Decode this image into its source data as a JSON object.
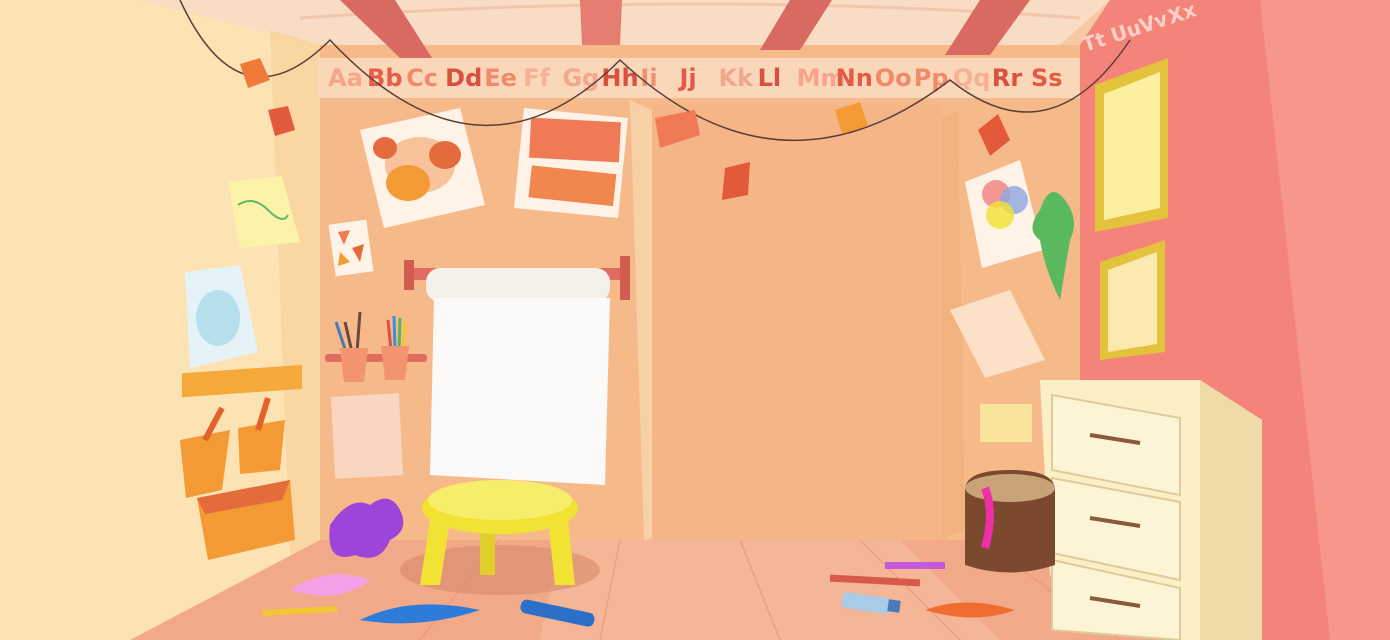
{
  "scene": {
    "alphabet": [
      "Aa",
      "Bb",
      "Cc",
      "Dd",
      "Ee",
      "Ff",
      "Gg",
      "Hh",
      "Ii",
      "Jj",
      "Kk",
      "Ll",
      "Mm",
      "Nn",
      "Oo",
      "Pp",
      "Qq",
      "Rr",
      "Ss"
    ],
    "alphabet_right": [
      "Tt",
      "Uu",
      "Vv",
      "Xx"
    ],
    "alphabet_colors": [
      "#f7a48a",
      "#e85c4a",
      "#f08a6a",
      "#d9503f",
      "#f08a6a",
      "#f7b096",
      "#f2a88e",
      "#d9503f",
      "#f28e73",
      "#e35a46",
      "#f2a88e",
      "#d9503f",
      "#f7a48a",
      "#e35a46",
      "#f08a6a",
      "#f08a6a",
      "#f7b096",
      "#d9503f",
      "#e35a46"
    ],
    "colors": {
      "back_wall": "#f6b98a",
      "left_wall": "#fde3b4",
      "right_wall": "#f4847a",
      "floor": "#f2a98a",
      "ceiling": "#f8dcc4",
      "beam": "#d86a62",
      "stool": "#f2e233",
      "dresser": "#fcefc6"
    }
  }
}
